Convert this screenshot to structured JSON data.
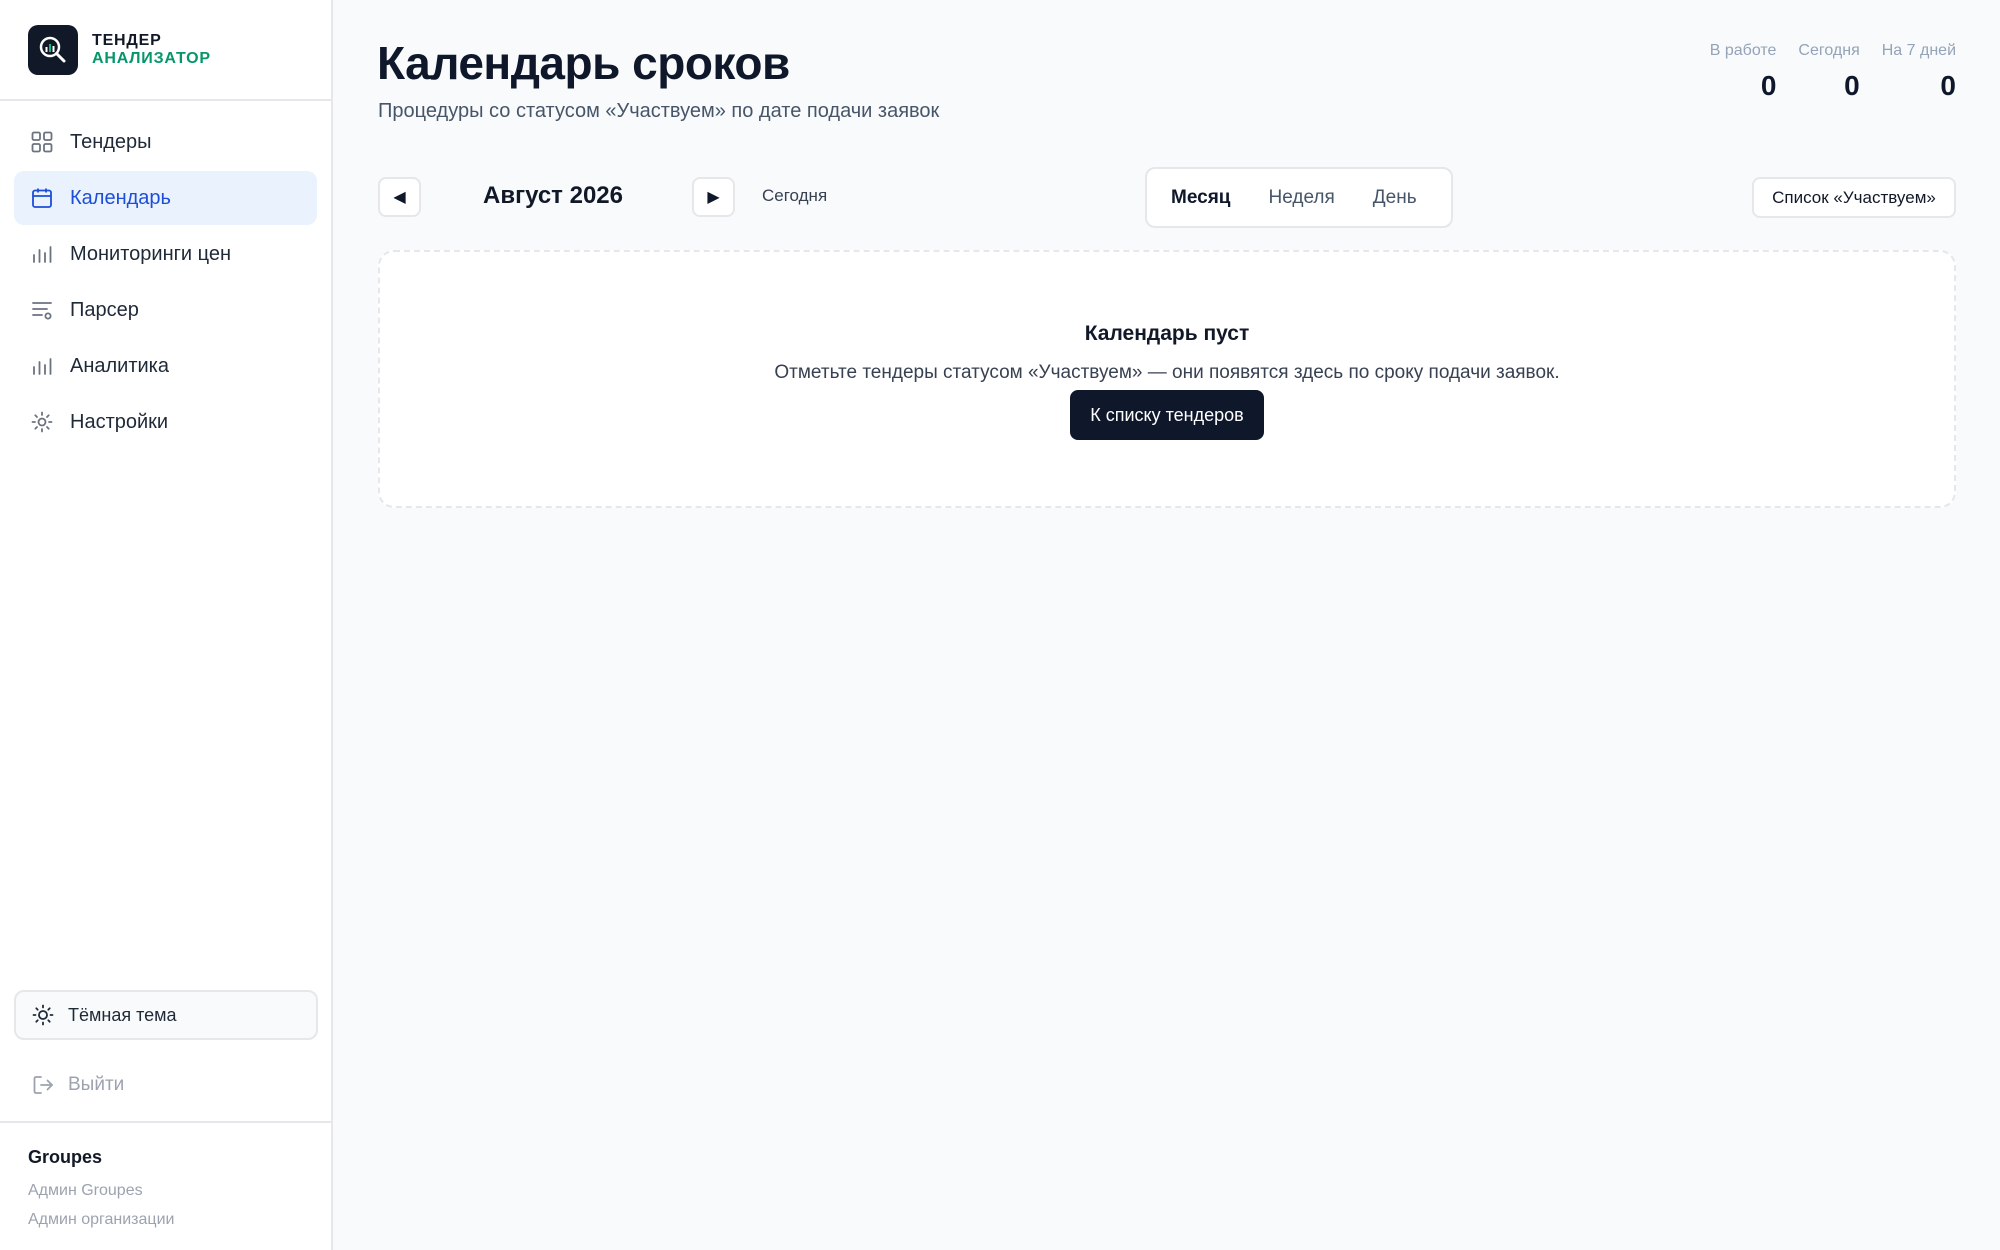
{
  "brand": {
    "line1": "ТЕНДЕР",
    "line2": "АНАЛИЗАТОР",
    "accent_color": "#059669"
  },
  "sidebar": {
    "items": [
      {
        "label": "Тендеры",
        "icon": "grid-icon",
        "active": false
      },
      {
        "label": "Календарь",
        "icon": "calendar-icon",
        "active": true
      },
      {
        "label": "Мониторинги цен",
        "icon": "bar-chart-icon",
        "active": false
      },
      {
        "label": "Парсер",
        "icon": "list-filter-icon",
        "active": false
      },
      {
        "label": "Аналитика",
        "icon": "bar-chart-icon",
        "active": false
      },
      {
        "label": "Настройки",
        "icon": "gear-icon",
        "active": false
      }
    ],
    "theme_toggle": "Тёмная тема",
    "logout": "Выйти",
    "org": {
      "name": "Groupes",
      "role1": "Админ Groupes",
      "role2": "Админ организации"
    }
  },
  "header": {
    "title": "Календарь сроков",
    "subtitle": "Процедуры со статусом «Участвуем» по дате подачи заявок"
  },
  "stats": [
    {
      "label": "В работе",
      "value": "0"
    },
    {
      "label": "Сегодня",
      "value": "0"
    },
    {
      "label": "На 7 дней",
      "value": "0"
    }
  ],
  "toolbar": {
    "prev": "◀",
    "next": "▶",
    "month": "Август 2026",
    "today": "Сегодня",
    "views": [
      "Месяц",
      "Неделя",
      "День"
    ],
    "active_view": "Месяц",
    "list_button": "Список «Участвуем»"
  },
  "empty_state": {
    "title": "Календарь пуст",
    "text": "Отметьте тендеры статусом «Участвуем» — они появятся здесь по сроку подачи заявок.",
    "button": "К списку тендеров"
  },
  "colors": {
    "active_nav_bg": "#eaf2fe",
    "active_nav_text": "#1d4ed8",
    "primary_button": "#0f172a"
  }
}
